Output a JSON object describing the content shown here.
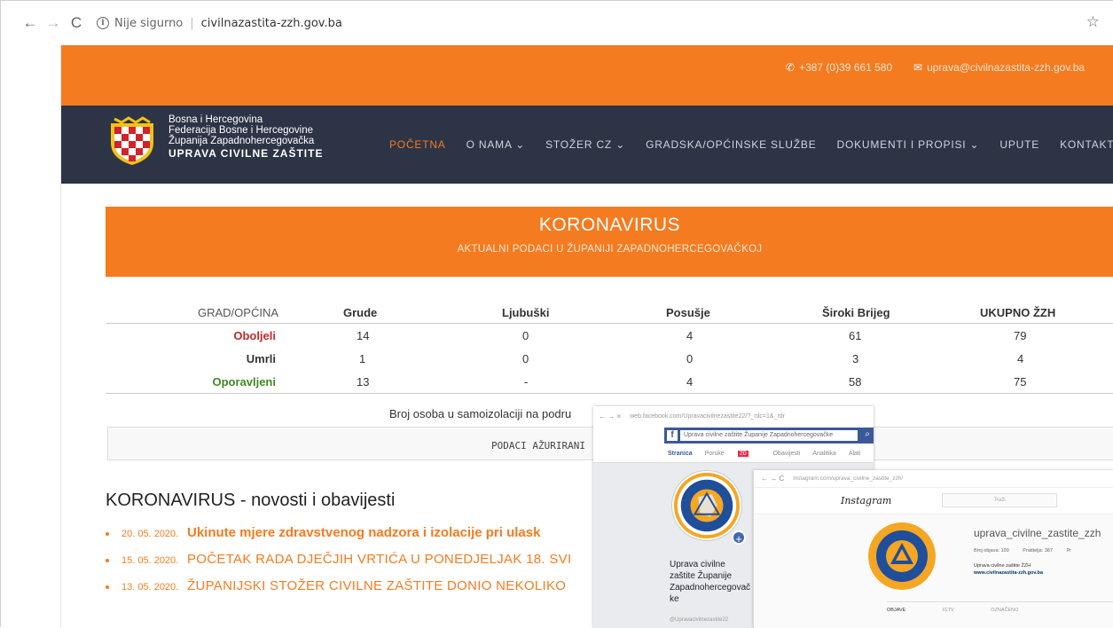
{
  "browser": {
    "not_secure": "Nije sigurno",
    "url": "civilnazastita-zzh.gov.ba"
  },
  "top_strip": {
    "phone": "+387 (0)39 661 580",
    "email": "uprava@civilnazastita-zzh.gov.ba"
  },
  "brand": {
    "line1": "Bosna i Hercegovina",
    "line2": "Federacija Bosne i Hercegovine",
    "line3": "Županija Zapadnohercegovačka",
    "line4": "UPRAVA CIVILNE ZAŠTITE"
  },
  "menu": {
    "items": [
      {
        "label": "POČETNA"
      },
      {
        "label": "O NAMA ⌄"
      },
      {
        "label": "STOŽER CZ ⌄"
      },
      {
        "label": "GRADSKA/OPĆINSKE SLUŽBE"
      },
      {
        "label": "DOKUMENTI I PROPISI ⌄"
      },
      {
        "label": "UPUTE"
      },
      {
        "label": "KONTAKT"
      }
    ]
  },
  "corona": {
    "title": "KORONAVIRUS",
    "subtitle": "AKTUALNI PODACI U ŽUPANIJI ZAPADNOHERCEGOVAČKOJ"
  },
  "stats": {
    "header": [
      "GRAD/OPĆINA",
      "Grude",
      "Ljubuški",
      "Posušje",
      "Široki Brijeg",
      "UKUPNO ŽZH"
    ],
    "rows": [
      {
        "label": "Oboljeli",
        "values": [
          "14",
          "0",
          "4",
          "61",
          "79"
        ]
      },
      {
        "label": "Umrli",
        "values": [
          "1",
          "0",
          "0",
          "3",
          "4"
        ]
      },
      {
        "label": "Oporavljeni",
        "values": [
          "13",
          "-",
          "4",
          "58",
          "75"
        ]
      }
    ],
    "isolation_pre": "Broj osoba u samoizolaciji na podru",
    "updated": "PODACI AŽURIRANI :"
  },
  "news": {
    "title": "KORONAVIRUS - novosti i obavijesti",
    "items": [
      {
        "date": "20. 05. 2020.",
        "text": "Ukinute mjere zdravstvenog nadzora i izolacije pri ulask"
      },
      {
        "date": "15. 05. 2020.",
        "text": "POČETAK RADA DJEČJIH VRTIĆA U PONEDJELJAK 18. SVI"
      },
      {
        "date": "13. 05. 2020.",
        "text": "ŽUPANIJSKI STOŽER CIVILNE ZAŠTITE DONIO NEKOLIKO"
      }
    ]
  },
  "facebook": {
    "url": "web.facebook.com/Upravacivilnezastite22/?_rdc=1&_rdr",
    "search": "Uprava civilne zaštite Županije Zapadnohercegovačke",
    "tabs": [
      {
        "label": "Stranica"
      },
      {
        "label": "Poruke"
      },
      {
        "label": "Obavijesti"
      },
      {
        "label": "Analitika"
      },
      {
        "label": "Alati"
      }
    ],
    "badge": "20",
    "name": "Uprava civilne zaštite Županije Zapadnohercegovač ke",
    "handle": "@Upravacivilnezastite22"
  },
  "instagram": {
    "url": "instagram.com/uprava_civilne_zastite_zzh/",
    "logo": "Instagram",
    "search": "Traži",
    "username": "uprava_civilne_zastite_zzh",
    "stats": [
      "Broj objava: 100",
      "Pratitelja: 387",
      "Pr"
    ],
    "bio_name": "Uprava civilne zaštite ŽZH",
    "bio_link": "www.civilnazastita-zzh.gov.ba",
    "tabs": [
      {
        "label": "OBJAVE"
      },
      {
        "label": "IGTV"
      },
      {
        "label": "OZNAČENO"
      }
    ]
  },
  "colors": {
    "accent": "#f47b20",
    "header_bg": "#2d3446",
    "red": "#c3282c",
    "green": "#3f8a24",
    "facebook": "#3b5998"
  }
}
